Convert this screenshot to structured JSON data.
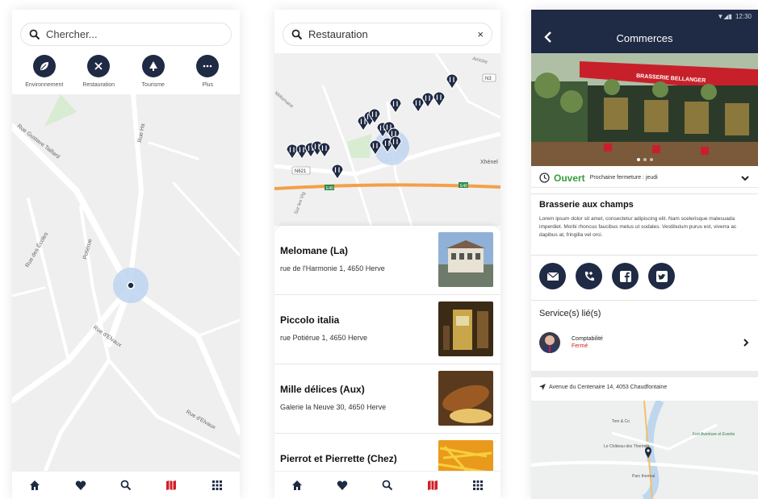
{
  "screen1": {
    "search_placeholder": "Chercher...",
    "categories": [
      {
        "label": "Environnement",
        "icon": "leaf-icon"
      },
      {
        "label": "Restauration",
        "icon": "utensils-icon"
      },
      {
        "label": "Tourisme",
        "icon": "tree-icon"
      },
      {
        "label": "Plus",
        "icon": "more-icon"
      }
    ],
    "streets": [
      "Rue Gustave Taillard",
      "Rue Ha",
      "Rue des Écoles",
      "Potiérue",
      "Rue d'Elvaux",
      "Rue d'Elvaux"
    ]
  },
  "screen2": {
    "search_value": "Restauration",
    "clear_label": "×",
    "map_labels": [
      "Arriche",
      "Mélomane",
      "N3",
      "Xhénel",
      "N621",
      "E40",
      "E40",
      "Sur les Vig"
    ],
    "results": [
      {
        "name": "Melomane (La)",
        "address": "rue de l'Harmonie 1, 4650 Herve"
      },
      {
        "name": "Piccolo italia",
        "address": "rue Potiérue 1, 4650 Herve"
      },
      {
        "name": "Mille délices (Aux)",
        "address": "Galerie la Neuve 30, 4650 Herve"
      },
      {
        "name": "Pierrot et Pierrette (Chez)",
        "address": ""
      }
    ]
  },
  "tabbar": [
    "home-icon",
    "heart-icon",
    "search-icon",
    "map-icon",
    "grid-icon"
  ],
  "screen3": {
    "status_time": "12:30",
    "header_title": "Commerces",
    "hero_sign": "BRASSERIE BELLANGER",
    "open_label": "Ouvert",
    "next_closing": "Prochaine fermeture : jeudi",
    "business_name": "Brasserie aux champs",
    "description": "Lorem ipsum dolor sit amet, consectetur adipiscing elit. Nam scelerisque malesuada imperdiet. Morbi rhoncus faucibus metus ut sodales. Vestibulum purus est, viverra ac dapibus at, fringilla vel orci.",
    "social": [
      "mail-icon",
      "phone-icon",
      "facebook-icon",
      "twitter-icon"
    ],
    "services_title": "Service(s) lié(s)",
    "service_name": "Comptabilité",
    "service_status": "Fermé",
    "address": "Avenue du Centenaire 14, 4053 Chaudfontaine",
    "map_labels": [
      "Tom & Co",
      "Fort Aventure et Events",
      "Le Château des Thermes",
      "Parc thermal"
    ]
  },
  "colors": {
    "navy": "#1f2a44",
    "open_green": "#3a9d3a",
    "closed_red": "#d02020",
    "active_tab_red": "#d0202a"
  }
}
